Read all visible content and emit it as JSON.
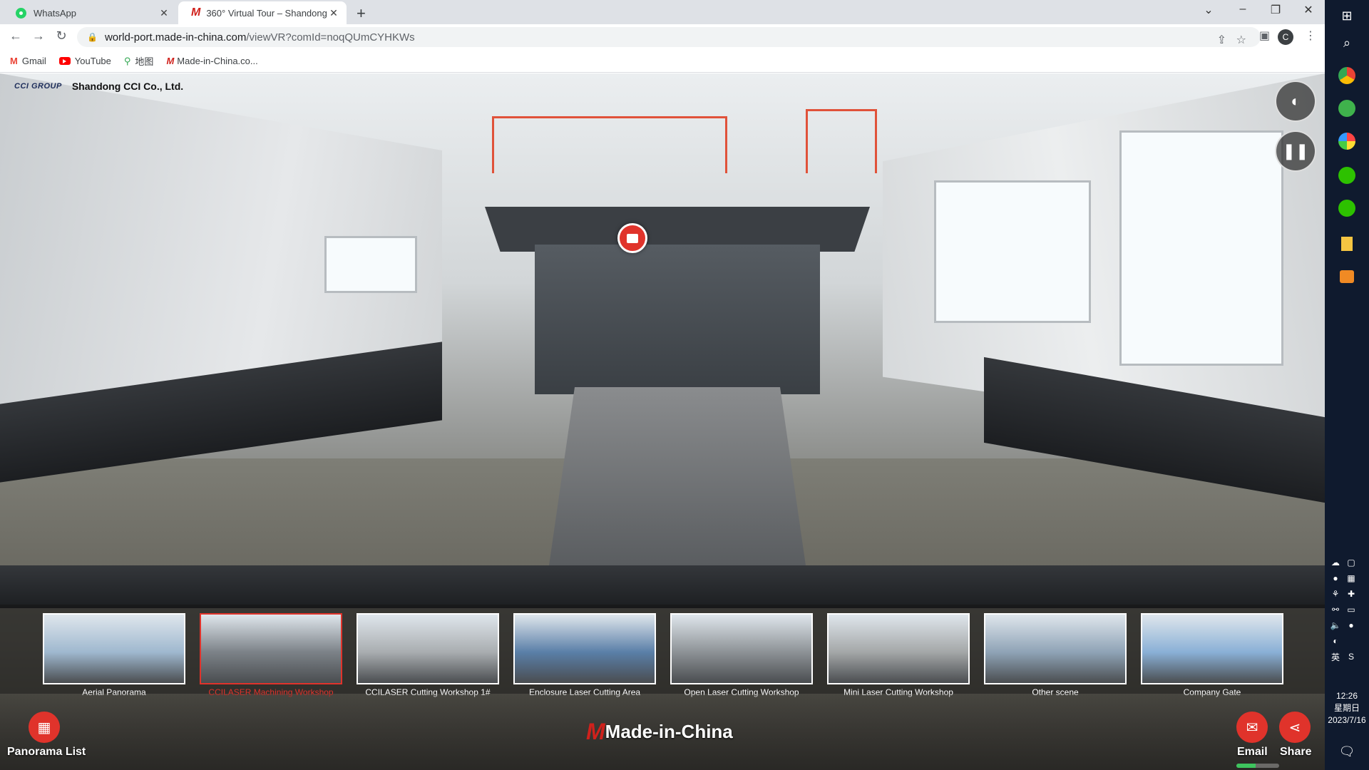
{
  "browser": {
    "tabs": [
      {
        "title": "WhatsApp",
        "active": false
      },
      {
        "title": "360° Virtual Tour – Shandong",
        "active": true
      }
    ],
    "new_tab_symbol": "+",
    "url_host": "world-port.made-in-china.com",
    "url_path": "/viewVR?comId=noqQUmCYHKWs",
    "profile_initial": "C",
    "bookmarks": [
      {
        "label": "Gmail",
        "icon": "gmail-icon"
      },
      {
        "label": "YouTube",
        "icon": "youtube-icon"
      },
      {
        "label": "地图",
        "icon": "maps-icon"
      },
      {
        "label": "Made-in-China.co...",
        "icon": "made-in-china-icon"
      }
    ]
  },
  "tour": {
    "company_logo_text": "CCI GROUP",
    "company_name": "Shandong CCI Co., Ltd.",
    "scenes": [
      {
        "label": "Aerial Panorama",
        "active": false,
        "tone": "#9fb8cf"
      },
      {
        "label": "CCILASER Machining Workshop",
        "active": true,
        "tone": "#7c8288"
      },
      {
        "label": "CCILASER Cutting Workshop 1#",
        "active": false,
        "tone": "#a9adb0"
      },
      {
        "label": "Enclosure Laser Cutting Area",
        "active": false,
        "tone": "#5a7fa8"
      },
      {
        "label": "Open Laser Cutting Workshop",
        "active": false,
        "tone": "#8d9296"
      },
      {
        "label": "Mini Laser Cutting Workshop",
        "active": false,
        "tone": "#a4a7a8"
      },
      {
        "label": "Other scene",
        "active": false,
        "tone": "#8fa3b6"
      },
      {
        "label": "Company Gate",
        "active": false,
        "tone": "#8ab0d6"
      }
    ],
    "panorama_list_label": "Panorama List",
    "email_label": "Email",
    "share_label": "Share",
    "footer_brand": "Made-in-China",
    "footer_brand_mark": "M",
    "loading_progress": 0.45,
    "accent_color": "#e0332b"
  },
  "taskbar": {
    "ime_label": "英",
    "time": "12:26",
    "weekday": "星期日",
    "date": "2023/7/16"
  }
}
